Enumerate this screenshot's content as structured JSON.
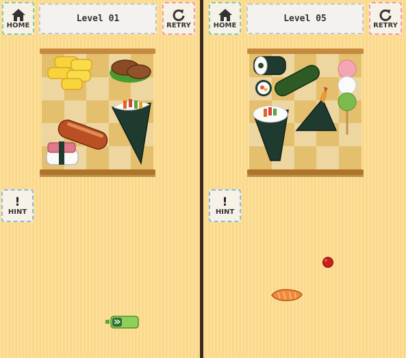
{
  "buttons": {
    "home": "HOME",
    "retry": "RETRY",
    "hint": "HINT",
    "hint_glyph": "!"
  },
  "screens": [
    {
      "level_label": "Level 01"
    },
    {
      "level_label": "Level 05"
    }
  ],
  "icons": {
    "home": "house-icon",
    "retry": "circular-arrow-icon",
    "hint": "exclamation-icon"
  },
  "foods_left": [
    "tamagoyaki",
    "hamburg-steak-on-pepper",
    "hand-roll-temaki",
    "sausage",
    "spam-musubi",
    "sushi-piece-green"
  ],
  "foods_right": [
    "futomaki-roll",
    "cucumber",
    "maki-roll-slice",
    "dango-skewer",
    "shrimp-tempura-onigiri",
    "ehomaki-roll",
    "umeboshi-piece",
    "salmon-piece"
  ]
}
